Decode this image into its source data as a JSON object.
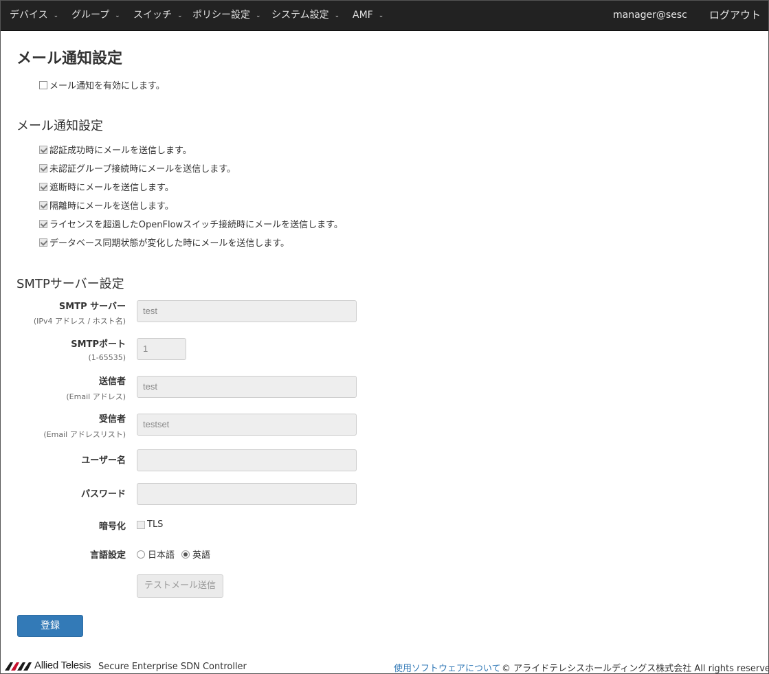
{
  "nav": {
    "items": [
      {
        "label": "デバイス"
      },
      {
        "label": "グループ"
      },
      {
        "label": "スイッチ"
      },
      {
        "label": "ポリシー設定"
      },
      {
        "label": "システム設定"
      },
      {
        "label": "AMF"
      }
    ],
    "user": "manager@sesc",
    "logout": "ログアウト"
  },
  "page": {
    "title": "メール通知設定",
    "enable_label": "メール通知を有効にします。",
    "enable_checked": false
  },
  "notify_section": {
    "heading": "メール通知設定",
    "options": [
      {
        "label": "認証成功時にメールを送信します。",
        "checked": true
      },
      {
        "label": "未認証グループ接続時にメールを送信します。",
        "checked": true
      },
      {
        "label": "遮断時にメールを送信します。",
        "checked": true
      },
      {
        "label": "隔離時にメールを送信します。",
        "checked": true
      },
      {
        "label": "ライセンスを超過したOpenFlowスイッチ接続時にメールを送信します。",
        "checked": true
      },
      {
        "label": "データベース同期状態が変化した時にメールを送信します。",
        "checked": true
      }
    ]
  },
  "smtp": {
    "heading": "SMTPサーバー設定",
    "server": {
      "label": "SMTP サーバー",
      "hint": "(IPv4 アドレス / ホスト名)",
      "value": "test"
    },
    "port": {
      "label": "SMTPポート",
      "hint": "(1-65535)",
      "value": "1"
    },
    "sender": {
      "label": "送信者",
      "hint": "(Email アドレス)",
      "value": "test"
    },
    "recipient": {
      "label": "受信者",
      "hint": "(Email アドレスリスト)",
      "value": "testset"
    },
    "username": {
      "label": "ユーザー名",
      "value": ""
    },
    "password": {
      "label": "パスワード",
      "value": ""
    },
    "encryption": {
      "label": "暗号化",
      "option": "TLS",
      "checked": false
    },
    "language": {
      "label": "言語設定",
      "options": [
        "日本語",
        "英語"
      ],
      "selected": "英語"
    },
    "test_button": "テストメール送信"
  },
  "submit_button": "登録",
  "footer": {
    "logo_text": "Allied Telesis",
    "product": "Secure Enterprise SDN Controller",
    "software_link": "使用ソフトウェアについて",
    "copyright": "© アライドテレシスホールディングス株式会社 All rights reserved."
  }
}
